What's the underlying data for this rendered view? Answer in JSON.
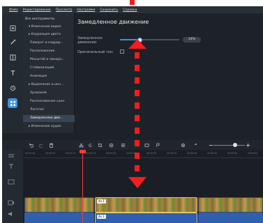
{
  "menu": [
    "Файл",
    "Редактирование",
    "Просмотр",
    "Настройки",
    "Сохранить",
    "Справка"
  ],
  "tree": [
    {
      "label": "Все инструменты",
      "level": 0
    },
    {
      "label": "▾ Изменение видео",
      "level": 1
    },
    {
      "label": "▸ Коррекция цвета",
      "level": 1
    },
    {
      "label": "Поворот и кадрир...",
      "level": 2
    },
    {
      "label": "Расположение",
      "level": 2
    },
    {
      "label": "Масштаб и панора...",
      "level": 2
    },
    {
      "label": "Стабилизация",
      "level": 2
    },
    {
      "label": "Анимация",
      "level": 2
    },
    {
      "label": "▸ Выделение и цен...",
      "level": 1
    },
    {
      "label": "Хромакей",
      "level": 2
    },
    {
      "label": "Распознавание сцен",
      "level": 2
    },
    {
      "label": "Логотип",
      "level": 2
    },
    {
      "label": "Замедленное дви...",
      "level": 2,
      "selected": true
    },
    {
      "label": "▸ Изменение аудио",
      "level": 1
    }
  ],
  "props": {
    "title": "Замедленное движение",
    "slowdown_label": "Замедленное движение:",
    "slowdown_value": "34%",
    "slowdown_fraction": 0.34,
    "original_tone_label": "Оригинальный тон:"
  },
  "clip_labels": {
    "a": "4x 1",
    "b": "4x 1"
  },
  "colors": {
    "accent": "#3f92e0",
    "annotation": "#f41d1d",
    "playhead": "#ff3b3b"
  }
}
